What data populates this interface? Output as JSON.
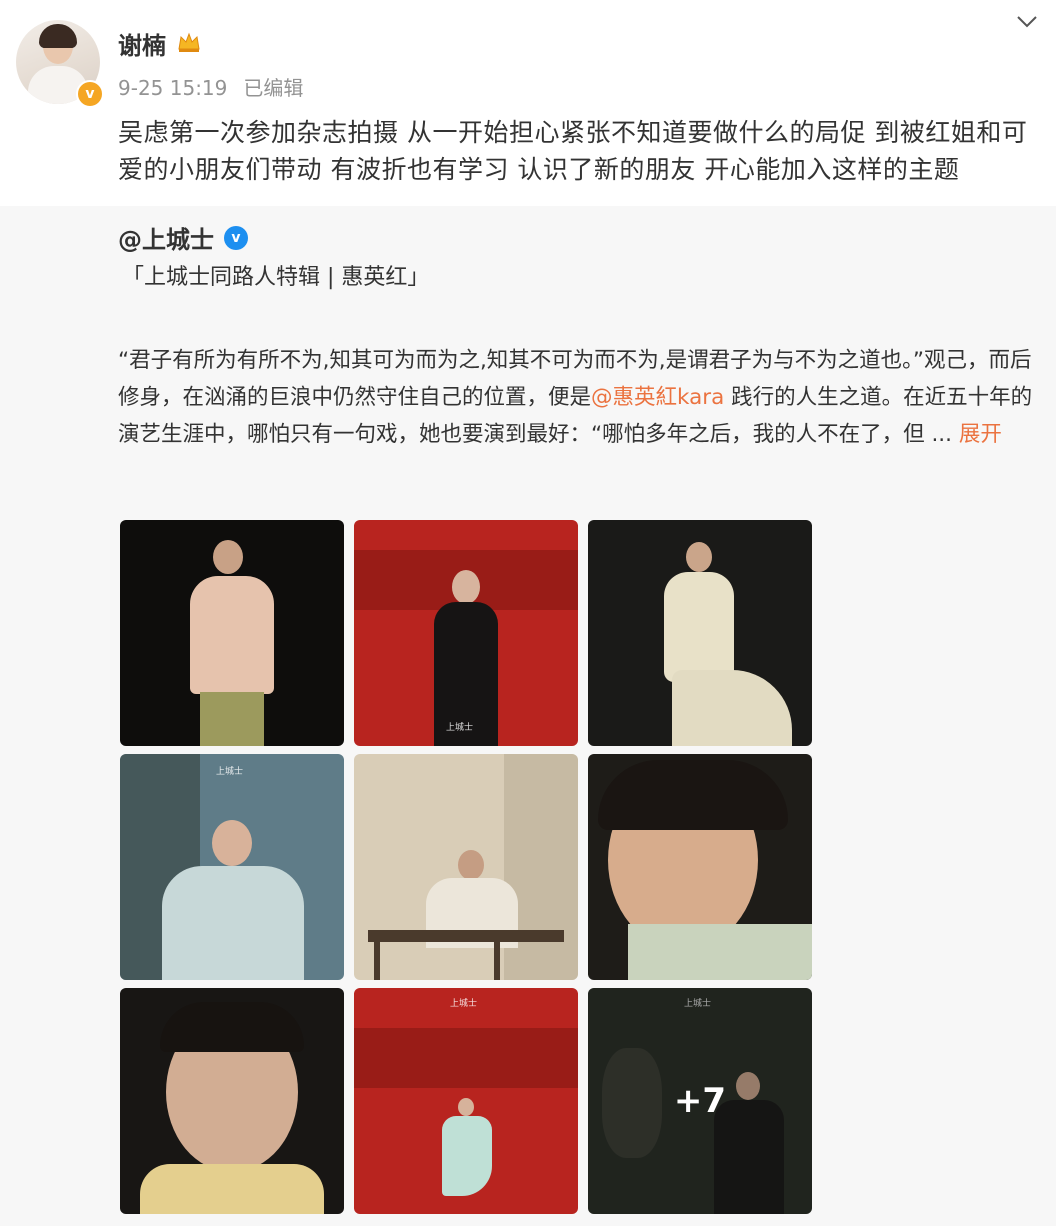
{
  "post": {
    "author": "谢楠",
    "timestamp": "9-25 15:19",
    "edited_label": "已编辑",
    "text": "吴虑第一次参加杂志拍摄 从一开始担心紧张不知道要做什么的局促 到被红姐和可爱的小朋友们带动 有波折也有学习 认识了新的朋友 开心能加入这样的主题",
    "avatar_badge": "v",
    "icons": [
      "crown-icon",
      "chevron-down-icon"
    ]
  },
  "repost": {
    "author": "@上城士",
    "verified_badge": "v",
    "title": "「上城士同路人特辑 | 惠英红」",
    "body_part1": "“君子有所为有所不为,知其可为而为之,知其不可为而不为,是谓君子为与不为之道也。”观己，而后修身，在汹涌的巨浪中仍然守住自己的位置，便是",
    "mention": "@惠英紅kara",
    "body_part2": " 践行的人生之道。在近五十年的演艺生涯中，哪怕只有一句戏，她也要演到最好：“哪怕多年之后，我的人不在了，但 ... ",
    "expand_label": "展开",
    "images": [
      {
        "label": "child-pink-jacket-photo"
      },
      {
        "label": "woman-black-robe-red-set-photo",
        "mark": "上城士"
      },
      {
        "label": "girl-white-gown-photo"
      },
      {
        "label": "child-blue-robe-pine-photo",
        "mark": "上城士"
      },
      {
        "label": "woman-guqin-landscape-photo"
      },
      {
        "label": "girl-closeup-profile-photo"
      },
      {
        "label": "girl-portrait-yellow-collar-photo"
      },
      {
        "label": "girl-blue-robe-red-set-photo",
        "mark": "上城士"
      },
      {
        "label": "child-dark-scene-photo",
        "mark": "上城士",
        "more_count": "+7"
      }
    ],
    "colors": {
      "accent": "#eb7340",
      "verified": "#1d8ff0",
      "orange_badge": "#f5a623"
    }
  }
}
